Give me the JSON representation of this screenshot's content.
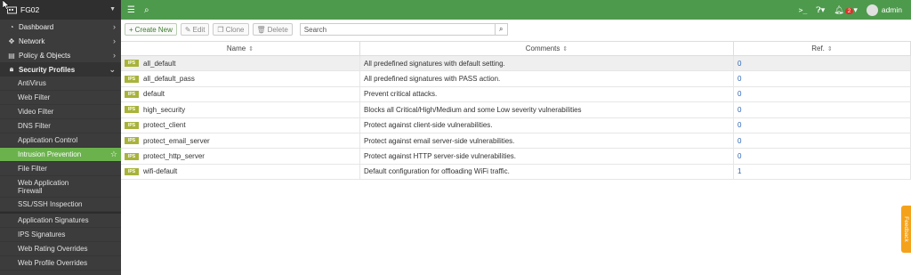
{
  "device": {
    "name": "FG02"
  },
  "sidebar": {
    "top_items": [
      {
        "label": "Dashboard",
        "icon": "dashboard-icon"
      },
      {
        "label": "Network",
        "icon": "network-icon"
      },
      {
        "label": "Policy & Objects",
        "icon": "policy-icon"
      },
      {
        "label": "Security Profiles",
        "icon": "lock-icon"
      }
    ],
    "sub_items": [
      {
        "label": "AntiVirus"
      },
      {
        "label": "Web Filter"
      },
      {
        "label": "Video Filter"
      },
      {
        "label": "DNS Filter"
      },
      {
        "label": "Application Control"
      },
      {
        "label": "Intrusion Prevention"
      },
      {
        "label": "File Filter"
      },
      {
        "label": "Web Application Firewall"
      },
      {
        "label": "SSL/SSH Inspection"
      },
      {
        "label": "Application Signatures"
      },
      {
        "label": "IPS Signatures"
      },
      {
        "label": "Web Rating Overrides"
      },
      {
        "label": "Web Profile Overrides"
      }
    ]
  },
  "topbar": {
    "notification_count": "2",
    "user": "admin"
  },
  "toolbar": {
    "create_label": "Create New",
    "edit_label": "Edit",
    "clone_label": "Clone",
    "delete_label": "Delete",
    "search_placeholder": "Search"
  },
  "table": {
    "columns": [
      "Name",
      "Comments",
      "Ref."
    ],
    "badge": "IPS",
    "rows": [
      {
        "name": "all_default",
        "comment": "All predefined signatures with default setting.",
        "ref": "0"
      },
      {
        "name": "all_default_pass",
        "comment": "All predefined signatures with PASS action.",
        "ref": "0"
      },
      {
        "name": "default",
        "comment": "Prevent critical attacks.",
        "ref": "0"
      },
      {
        "name": "high_security",
        "comment": "Blocks all Critical/High/Medium and some Low severity vulnerabilities",
        "ref": "0"
      },
      {
        "name": "protect_client",
        "comment": "Protect against client-side vulnerabilities.",
        "ref": "0"
      },
      {
        "name": "protect_email_server",
        "comment": "Protect against email server-side vulnerabilities.",
        "ref": "0"
      },
      {
        "name": "protect_http_server",
        "comment": "Protect against HTTP server-side vulnerabilities.",
        "ref": "0"
      },
      {
        "name": "wifi-default",
        "comment": "Default configuration for offloading WiFi traffic.",
        "ref": "1"
      }
    ]
  },
  "feedback_label": "Feedback",
  "colors": {
    "accent": "#4e9a4d",
    "active_nav": "#6bb24d",
    "sidebar": "#3c3c3c",
    "ips_badge": "#a8b33a",
    "feedback": "#f4a21b"
  }
}
